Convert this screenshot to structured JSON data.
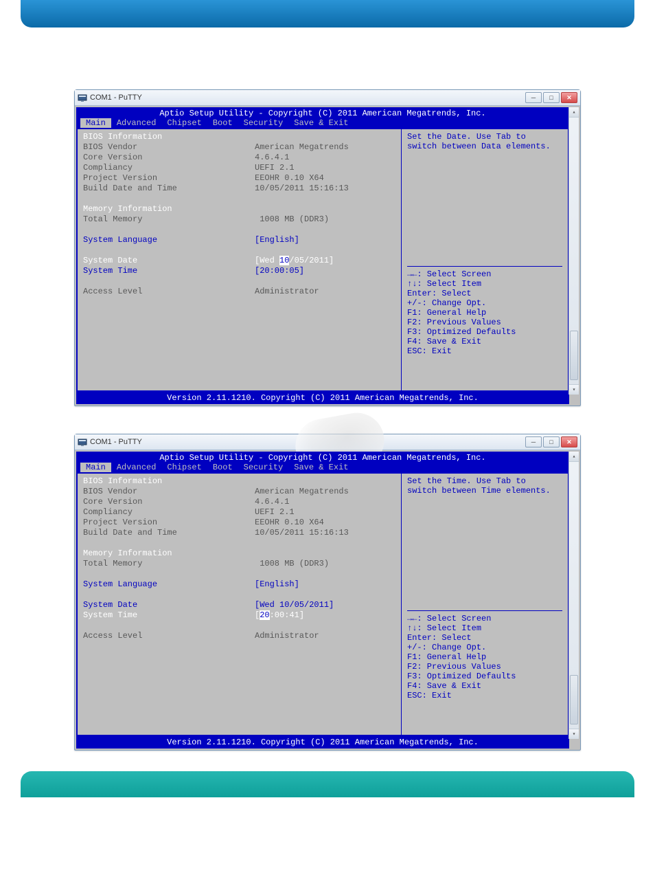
{
  "window_title": "COM1 - PuTTY",
  "scroll": {
    "up_glyph": "▴",
    "down_glyph": "▾"
  },
  "win_buttons": {
    "min": "─",
    "max": "□",
    "close": "✕"
  },
  "bios_header": "Aptio Setup Utility - Copyright (C) 2011 American Megatrends, Inc.",
  "menu": [
    "Main",
    "Advanced",
    "Chipset",
    "Boot",
    "Security",
    "Save & Exit"
  ],
  "active_menu_index": 0,
  "left_panel": {
    "bios_info_heading": "BIOS Information",
    "rows": [
      {
        "label": "BIOS Vendor",
        "value": "American Megatrends"
      },
      {
        "label": "Core Version",
        "value": "4.6.4.1"
      },
      {
        "label": "Compliancy",
        "value": "UEFI 2.1"
      },
      {
        "label": "Project Version",
        "value": "EEOHR 0.10 X64"
      },
      {
        "label": "Build Date and Time",
        "value": "10/05/2011 15:16:13"
      }
    ],
    "mem_heading": "Memory Information",
    "mem_row": {
      "label": "Total Memory",
      "value": " 1008 MB (DDR3)"
    },
    "lang_row": {
      "label": "System Language",
      "value": "[English]"
    },
    "date_row": {
      "label": "System Date",
      "value_prefix": "[Wed ",
      "value_hl": "10",
      "value_suffix": "/05/2011]"
    },
    "time_row": {
      "label": "System Time",
      "value": "[20:00:05]"
    },
    "access_row": {
      "label": "Access Level",
      "value": "Administrator"
    }
  },
  "left_panel_b": {
    "date_row": {
      "label": "System Date",
      "value": "[Wed 10/05/2011]"
    },
    "time_row": {
      "label": "System Time",
      "value_prefix": "[",
      "value_hl": "20",
      "value_suffix": ":00:41]"
    }
  },
  "right_panel_a": {
    "help1": "Set the Date. Use Tab to",
    "help2": "switch between Data elements."
  },
  "right_panel_b": {
    "help1": "Set the Time. Use Tab to",
    "help2": "switch between Time elements."
  },
  "keys": [
    "→←: Select Screen",
    "↑↓: Select Item",
    "Enter: Select",
    "+/-: Change Opt.",
    "F1: General Help",
    "F2: Previous Values",
    "F3: Optimized Defaults",
    "F4: Save & Exit",
    "ESC: Exit"
  ],
  "bios_footer": "Version 2.11.1210. Copyright (C) 2011 American Megatrends, Inc."
}
